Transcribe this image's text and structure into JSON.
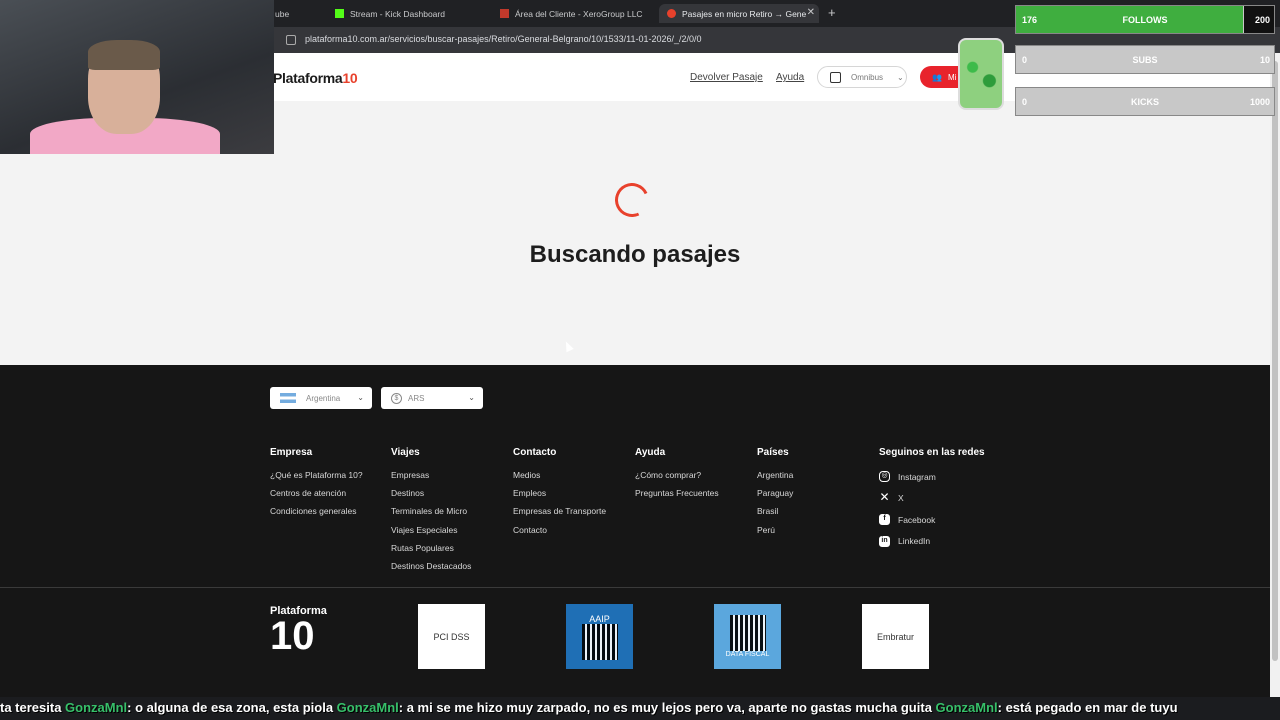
{
  "browser": {
    "tabs": [
      {
        "label": "ube",
        "active": false
      },
      {
        "label": "Stream - Kick Dashboard",
        "active": false
      },
      {
        "label": "Área del Cliente - XeroGroup LLC",
        "active": false
      },
      {
        "label": "Pasajes en micro Retiro → Gene",
        "active": true
      }
    ],
    "url": "plataforma10.com.ar/servicios/buscar-pasajes/Retiro/General-Belgrano/10/1533/11-01-2026/_/2/0/0"
  },
  "site": {
    "logo_main": "Plataforma",
    "logo_accent": "10",
    "header_links": [
      "Devolver Pasaje",
      "Ayuda"
    ],
    "transport_select": "Omnibus",
    "account_button": "Mi"
  },
  "main": {
    "status_text": "Buscando pasajes"
  },
  "footer": {
    "country_select": "Argentina",
    "currency_select": "ARS",
    "columns": [
      {
        "title": "Empresa",
        "links": [
          "¿Qué es Plataforma 10?",
          "Centros de atención",
          "Condiciones generales"
        ]
      },
      {
        "title": "Viajes",
        "links": [
          "Empresas",
          "Destinos",
          "Terminales de Micro",
          "Viajes Especiales",
          "Rutas Populares",
          "Destinos Destacados"
        ]
      },
      {
        "title": "Contacto",
        "links": [
          "Medios",
          "Empleos",
          "Empresas de Transporte",
          "Contacto"
        ]
      },
      {
        "title": "Ayuda",
        "links": [
          "¿Cómo comprar?",
          "Preguntas Frecuentes"
        ]
      },
      {
        "title": "Países",
        "links": [
          "Argentina",
          "Paraguay",
          "Brasil",
          "Perú"
        ]
      }
    ],
    "social_title": "Seguinos en las redes",
    "social": [
      "Instagram",
      "X",
      "Facebook",
      "LinkedIn"
    ],
    "badges": [
      "PCI DSS",
      "AAIP",
      "DATA FISCAL",
      "Embratur"
    ],
    "bottom_logo_top": "Plataforma",
    "bottom_logo_bottom": "10"
  },
  "overlay": {
    "follows": {
      "label": "FOLLOWS",
      "count": "176",
      "goal": "200",
      "progress": 0.88
    },
    "subs": {
      "label": "SUBS",
      "count": "0",
      "goal": "10"
    },
    "kicks": {
      "label": "KICKS",
      "count": "0",
      "goal": "1000"
    }
  },
  "chat": {
    "segments": [
      {
        "user": "",
        "text": "ta teresita "
      },
      {
        "user": "GonzaMnl",
        "text": ": o alguna de esa zona, esta piola "
      },
      {
        "user": "GonzaMnl",
        "text": ": a mi se me hizo muy zarpado, no es muy lejos pero va, aparte no gastas mucha guita "
      },
      {
        "user": "GonzaMnl",
        "text": ": está pegado en mar de tuyu"
      }
    ]
  }
}
